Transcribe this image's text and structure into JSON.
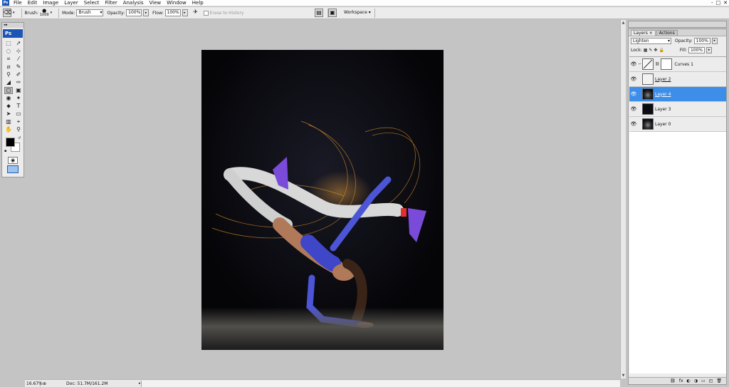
{
  "menubar": {
    "logo": "Ps",
    "items": [
      "File",
      "Edit",
      "Image",
      "Layer",
      "Select",
      "Filter",
      "Analysis",
      "View",
      "Window",
      "Help"
    ],
    "window_controls": [
      "-",
      "□",
      "✕"
    ]
  },
  "options": {
    "brush_label": "Brush:",
    "brush_size": "1009",
    "mode_label": "Mode:",
    "mode_value": "Brush",
    "opacity_label": "Opacity:",
    "opacity_value": "100%",
    "flow_label": "Flow:",
    "flow_value": "100%",
    "erase_to_history": "Erase to History",
    "workspace_label": "Workspace ▾"
  },
  "toolbox": {
    "badge": "Ps",
    "tools": [
      "⬚",
      "➚",
      "◌",
      "⊹",
      "⌗",
      "⁄",
      "⧄",
      "✎",
      "⚲",
      "✐",
      "◢",
      "✑",
      "◻",
      "▣",
      "◉",
      "✦",
      "⬥",
      "T",
      "➤",
      "▭",
      "▥",
      "⌖",
      "✋",
      "⚲"
    ],
    "active_index": 12
  },
  "status": {
    "zoom": "16.67%",
    "doc": "Doc: 51.7M/161.2M"
  },
  "layers": {
    "tab_layers": "Layers ×",
    "tab_actions": "Actions",
    "blend_mode": "Lighten",
    "opacity_label": "Opacity:",
    "opacity_value": "100%",
    "lock_label": "Lock:",
    "fill_label": "Fill:",
    "fill_value": "100%",
    "items": [
      {
        "name": "Curves 1"
      },
      {
        "name": "Layer 2"
      },
      {
        "name": "Layer 4"
      },
      {
        "name": "Layer 3"
      },
      {
        "name": "Layer 0"
      }
    ],
    "bottom_icons": [
      "⛓",
      "fx",
      "◐",
      "◑",
      "▭",
      "◰",
      "🗑"
    ]
  }
}
